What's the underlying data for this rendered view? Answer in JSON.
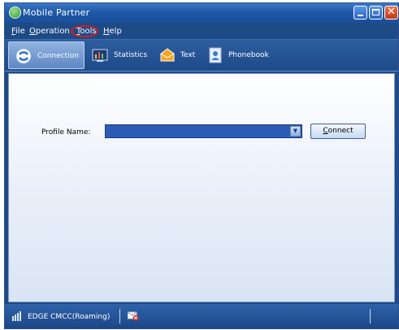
{
  "window": {
    "title": "Mobile Partner"
  },
  "menu": [
    {
      "accel": "F",
      "rest": "ile"
    },
    {
      "accel": "O",
      "rest": "peration"
    },
    {
      "accel": "T",
      "rest": "ools"
    },
    {
      "accel": "H",
      "rest": "elp"
    }
  ],
  "tabs": [
    {
      "label": "Connection",
      "icon": "connection-icon",
      "active": true
    },
    {
      "label": "Statistics",
      "icon": "statistics-icon",
      "active": false
    },
    {
      "label": "Text",
      "icon": "envelope-icon",
      "active": false
    },
    {
      "label": "Phonebook",
      "icon": "phonebook-icon",
      "active": false
    }
  ],
  "main": {
    "profile_label": "Profile Name:",
    "profile_value": "",
    "connect_accel": "C",
    "connect_rest": "onnect"
  },
  "status": {
    "network": "EDGE CMCC(Roaming)"
  },
  "colors": {
    "highlight_circle": "#d41f1f",
    "titlebar": "#1f58a8"
  }
}
